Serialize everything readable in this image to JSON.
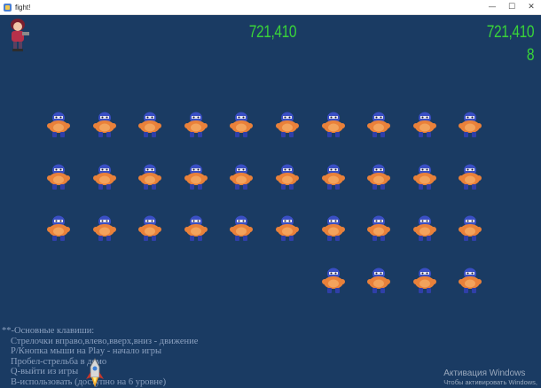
{
  "window": {
    "title": "fight!",
    "minimize": "—",
    "maximize": "☐",
    "close": "✕"
  },
  "hud": {
    "score": "721,410",
    "best_score": "721,410",
    "level": "8"
  },
  "enemies": {
    "rows": [
      10,
      10,
      10,
      4
    ],
    "sprite": "blue-masked-brawler-icon"
  },
  "player": {
    "sprite": "brawler-avatar-icon"
  },
  "projectile": {
    "sprite": "rocket-icon"
  },
  "instructions": [
    "**-Основные клавиши:",
    "Стрелочки вправо,влево,вверх,вниз - движение",
    "P/Кнопка мыши на Play - начало игры",
    "Пробел-стрельба в демо",
    "Q-выйти из игры",
    "B-использовать (доступно на 6 уровне)"
  ],
  "activation": {
    "title": "Активация Windows",
    "subtitle": "Чтобы активировать Windows,"
  }
}
